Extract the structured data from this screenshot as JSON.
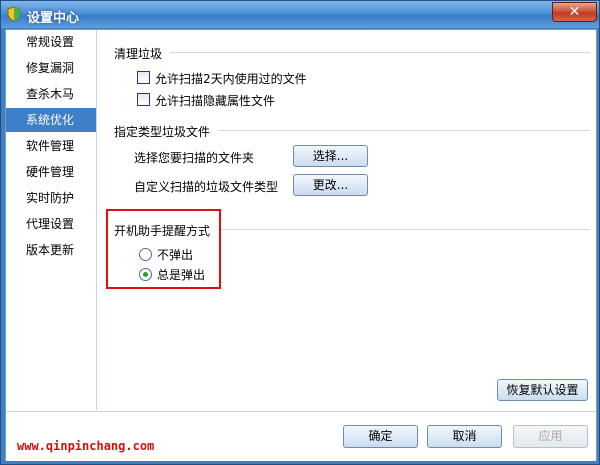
{
  "window": {
    "title": "设置中心",
    "close_symbol": "✕"
  },
  "sidebar": {
    "items": [
      {
        "label": "常规设置",
        "active": false
      },
      {
        "label": "修复漏洞",
        "active": false
      },
      {
        "label": "查杀木马",
        "active": false
      },
      {
        "label": "系统优化",
        "active": true
      },
      {
        "label": "软件管理",
        "active": false
      },
      {
        "label": "硬件管理",
        "active": false
      },
      {
        "label": "实时防护",
        "active": false
      },
      {
        "label": "代理设置",
        "active": false
      },
      {
        "label": "版本更新",
        "active": false
      }
    ]
  },
  "cleanup": {
    "title": "清理垃圾",
    "options": [
      {
        "label": "允许扫描2天内使用过的文件",
        "checked": false
      },
      {
        "label": "允许扫描隐藏属性文件",
        "checked": false
      }
    ]
  },
  "typed_junk": {
    "title": "指定类型垃圾文件",
    "choose_folder_label": "选择您要扫描的文件夹",
    "choose_button": "选择...",
    "custom_types_label": "自定义扫描的垃圾文件类型",
    "change_button": "更改..."
  },
  "startup_reminder": {
    "title": "开机助手提醒方式",
    "options": [
      {
        "label": "不弹出",
        "selected": false
      },
      {
        "label": "总是弹出",
        "selected": true
      }
    ]
  },
  "restore_default_button": "恢复默认设置",
  "footer": {
    "ok": "确定",
    "cancel": "取消",
    "apply": "应用",
    "apply_enabled": false
  },
  "watermark": "www.qinpinchang.com",
  "colors": {
    "titlebar": "#4d8fd6",
    "selected_item": "#3d7fc8",
    "highlight_box": "#e01010",
    "watermark": "#d01010"
  }
}
